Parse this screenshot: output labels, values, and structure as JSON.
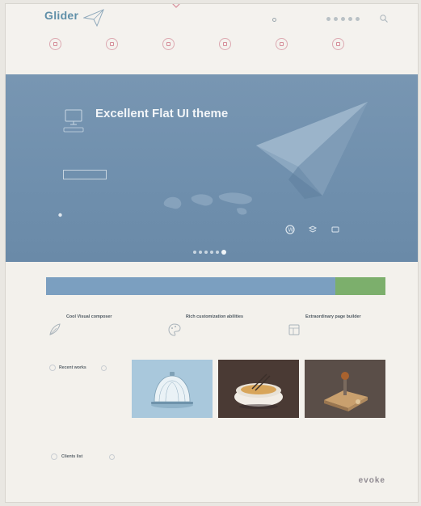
{
  "header": {
    "logo_title": "Glider",
    "logo_sub": "",
    "lang": "",
    "search_placeholder": "",
    "nav": [
      {
        "label": "",
        "desc": ""
      },
      {
        "label": "",
        "desc": ""
      },
      {
        "label": "",
        "desc": ""
      },
      {
        "label": "",
        "desc": ""
      },
      {
        "label": "",
        "desc": ""
      },
      {
        "label": "",
        "desc": ""
      }
    ]
  },
  "hero": {
    "title": "Excellent Flat UI theme",
    "subtitle": "",
    "description": "",
    "button_label": "",
    "note": "",
    "slides": 6,
    "active_slide": 6
  },
  "banner": {
    "text": "",
    "button_label": ""
  },
  "features": [
    {
      "title": "Cool Visual composer",
      "text": "",
      "icon": "feather-icon"
    },
    {
      "title": "Rich customization abilities",
      "text": "",
      "icon": "paint-palette-icon"
    },
    {
      "title": "Extraordinary page builder",
      "text": "",
      "icon": "layout-builder-icon"
    }
  ],
  "recent": {
    "title": "Recent works",
    "text": "",
    "works": [
      {
        "title": "",
        "category": ""
      },
      {
        "title": "",
        "category": ""
      },
      {
        "title": "",
        "category": ""
      }
    ]
  },
  "clients": {
    "title": "Clients list",
    "logos": [
      "",
      "",
      "",
      "",
      "evoke"
    ]
  },
  "colors": {
    "accent": "#5f8fa8",
    "hero_bg": "#7391ae",
    "banner_bg": "#7b9fc0",
    "banner_button": "#7caf6c",
    "nav_icon": "#dca8b0"
  }
}
